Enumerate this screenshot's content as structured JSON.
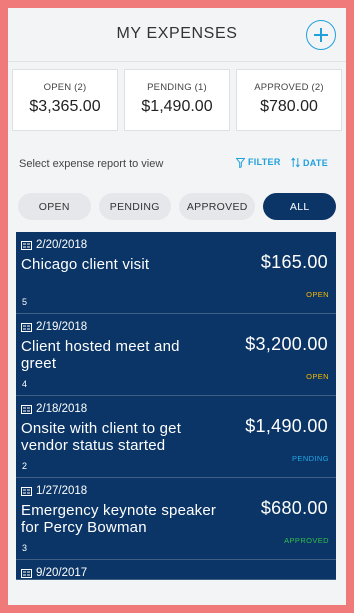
{
  "header": {
    "title": "MY EXPENSES",
    "add_icon": "plus-circle-icon"
  },
  "summary": [
    {
      "label": "OPEN (2)",
      "amount": "$3,365.00"
    },
    {
      "label": "PENDING (1)",
      "amount": "$1,490.00"
    },
    {
      "label": "APPROVED (2)",
      "amount": "$780.00"
    }
  ],
  "filter": {
    "prompt": "Select expense report to view",
    "filter_label": "FILTER",
    "date_label": "DATE",
    "filter_icon": "funnel-icon",
    "date_icon": "sort-icon"
  },
  "tabs": [
    {
      "label": "OPEN",
      "active": false
    },
    {
      "label": "PENDING",
      "active": false
    },
    {
      "label": "APPROVED",
      "active": false
    },
    {
      "label": "ALL",
      "active": true
    }
  ],
  "colors": {
    "navy": "#0b3566",
    "accent": "#21a1dc",
    "open": "#f5b800",
    "pending": "#1ea7e8",
    "approved": "#2fbf4a"
  },
  "expenses": [
    {
      "date": "2/20/2018",
      "title": "Chicago client visit",
      "amount": "$165.00",
      "count": "5",
      "status": "OPEN"
    },
    {
      "date": "2/19/2018",
      "title": "Client hosted meet and greet",
      "amount": "$3,200.00",
      "count": "4",
      "status": "OPEN"
    },
    {
      "date": "2/18/2018",
      "title": "Onsite with client to get vendor status started",
      "amount": "$1,490.00",
      "count": "2",
      "status": "PENDING"
    },
    {
      "date": "1/27/2018",
      "title": "Emergency keynote speaker for Percy Bowman",
      "amount": "$680.00",
      "count": "3",
      "status": "APPROVED"
    },
    {
      "date": "9/20/2017",
      "title": "",
      "amount": "",
      "count": "",
      "status": ""
    }
  ]
}
